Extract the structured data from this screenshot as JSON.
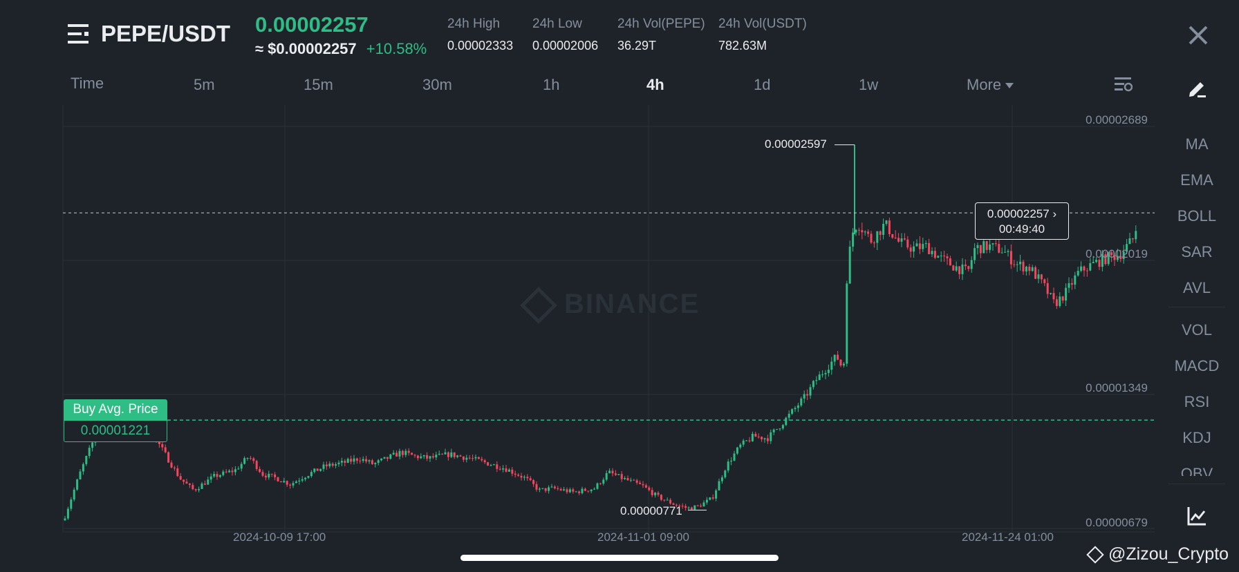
{
  "header": {
    "pair": "PEPE/USDT",
    "price": "0.00002257",
    "usd_price": "≈ $0.00002257",
    "change": "+10.58%",
    "stats": [
      {
        "label": "24h High",
        "value": "0.00002333"
      },
      {
        "label": "24h Low",
        "value": "0.00002006"
      },
      {
        "label": "24h Vol(PEPE)",
        "value": "36.29T"
      },
      {
        "label": "24h Vol(USDT)",
        "value": "782.63M"
      }
    ]
  },
  "timeframes": {
    "time": "Time",
    "items": [
      "5m",
      "15m",
      "30m",
      "1h",
      "4h",
      "1d",
      "1w"
    ],
    "active": "4h",
    "more": "More"
  },
  "sidebar": {
    "indicators_top": [
      "MA",
      "EMA",
      "BOLL",
      "SAR",
      "AVL"
    ],
    "indicators_bottom": [
      "VOL",
      "MACD",
      "RSI",
      "KDJ",
      "OBV"
    ]
  },
  "chart_data": {
    "type": "candlestick",
    "y_axis_labels": [
      "0.00002689",
      "0.00002019",
      "0.00001349",
      "0.00000679"
    ],
    "x_axis_labels": [
      "2024-10-09 17:00",
      "2024-11-01 09:00",
      "2024-11-24 01:00"
    ],
    "ylim": [
      6.79e-06,
      2.689e-05
    ],
    "high_label": "0.00002597",
    "low_label": "0.00000771",
    "current_price": "0.00002257",
    "countdown": "00:49:40",
    "buy_avg_label": "Buy Avg. Price",
    "buy_avg_price": "0.00001221",
    "watermark": "BINANCE",
    "colors": {
      "up": "#2ebd85",
      "down": "#f6465d",
      "grid": "#2b3139"
    }
  },
  "footer": {
    "credit": "@Zizou_Crypto"
  }
}
